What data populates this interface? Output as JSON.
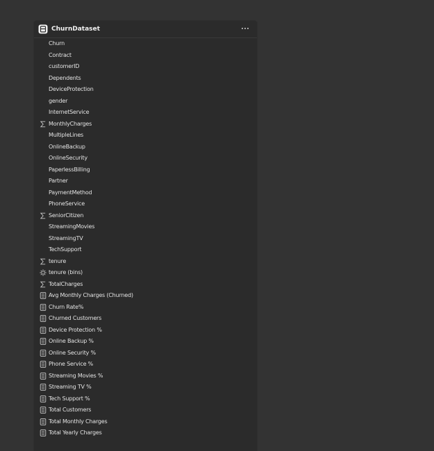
{
  "table": {
    "title": "ChurnDataset",
    "more_label": "···"
  },
  "fields": [
    {
      "label": "Churn",
      "icon": "none"
    },
    {
      "label": "Contract",
      "icon": "none"
    },
    {
      "label": "customerID",
      "icon": "none"
    },
    {
      "label": "Dependents",
      "icon": "none"
    },
    {
      "label": "DeviceProtection",
      "icon": "none"
    },
    {
      "label": "gender",
      "icon": "none"
    },
    {
      "label": "InternetService",
      "icon": "none"
    },
    {
      "label": "MonthlyCharges",
      "icon": "sigma-icon"
    },
    {
      "label": "MultipleLines",
      "icon": "none"
    },
    {
      "label": "OnlineBackup",
      "icon": "none"
    },
    {
      "label": "OnlineSecurity",
      "icon": "none"
    },
    {
      "label": "PaperlessBilling",
      "icon": "none"
    },
    {
      "label": "Partner",
      "icon": "none"
    },
    {
      "label": "PaymentMethod",
      "icon": "none"
    },
    {
      "label": "PhoneService",
      "icon": "none"
    },
    {
      "label": "SeniorCitizen",
      "icon": "sigma-icon"
    },
    {
      "label": "StreamingMovies",
      "icon": "none"
    },
    {
      "label": "StreamingTV",
      "icon": "none"
    },
    {
      "label": "TechSupport",
      "icon": "none"
    },
    {
      "label": "tenure",
      "icon": "sigma-icon"
    },
    {
      "label": "tenure (bins)",
      "icon": "bins-icon"
    },
    {
      "label": "TotalCharges",
      "icon": "sigma-icon"
    },
    {
      "label": "Avg Monthly Charges (Churned)",
      "icon": "measure-icon"
    },
    {
      "label": "Churn Rate%",
      "icon": "measure-icon"
    },
    {
      "label": "Churned Customers",
      "icon": "measure-icon"
    },
    {
      "label": "Device Protection %",
      "icon": "measure-icon"
    },
    {
      "label": "Online Backup %",
      "icon": "measure-icon"
    },
    {
      "label": "Online Security %",
      "icon": "measure-icon"
    },
    {
      "label": "Phone Service %",
      "icon": "measure-icon"
    },
    {
      "label": "Streaming Movies %",
      "icon": "measure-icon"
    },
    {
      "label": "Streaming TV %",
      "icon": "measure-icon"
    },
    {
      "label": "Tech Support %",
      "icon": "measure-icon"
    },
    {
      "label": "Total Customers",
      "icon": "measure-icon"
    },
    {
      "label": "Total Monthly Charges",
      "icon": "measure-icon"
    },
    {
      "label": "Total Yearly Charges",
      "icon": "measure-icon"
    }
  ],
  "colors": {
    "background": "#333333",
    "panel": "#2b2b2b",
    "text": "#e3e3e3",
    "icon": "#c8c8c8"
  }
}
